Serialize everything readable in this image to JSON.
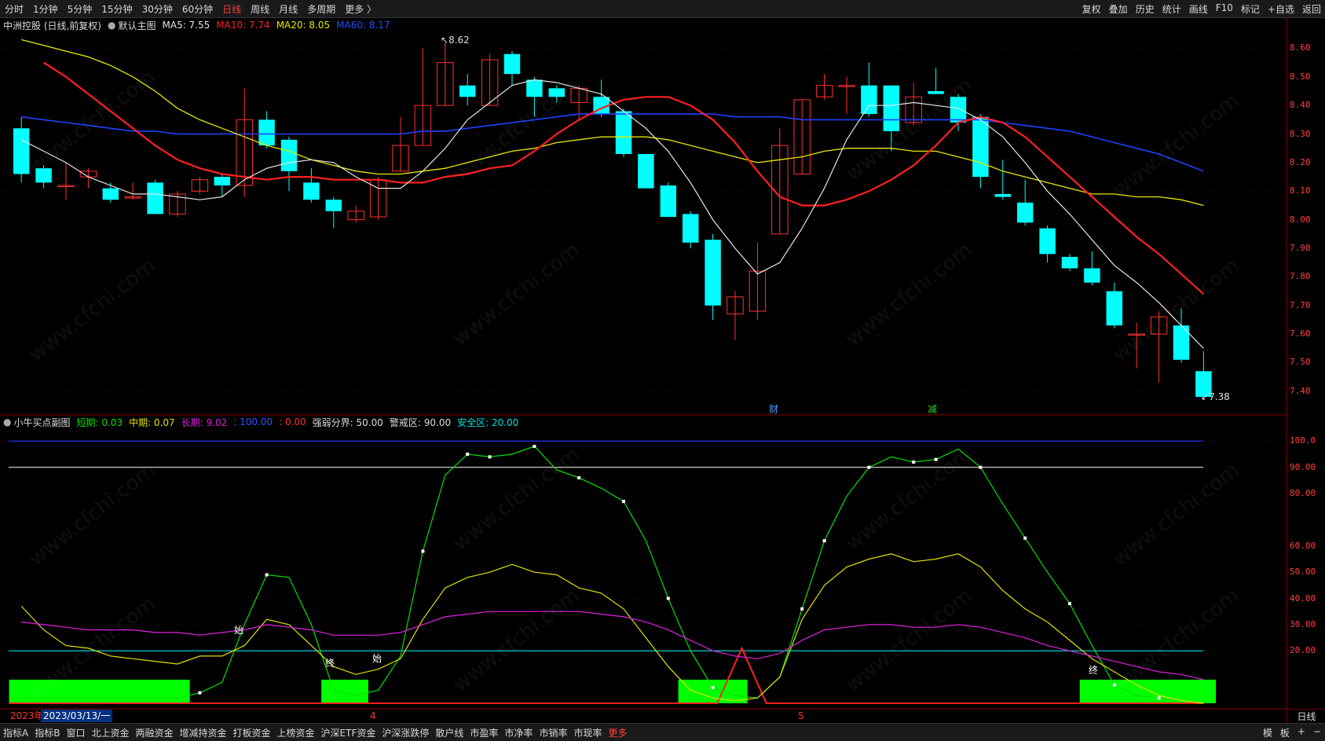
{
  "top_tabs": [
    {
      "label": "分时",
      "active": false
    },
    {
      "label": "1分钟",
      "active": false
    },
    {
      "label": "5分钟",
      "active": false
    },
    {
      "label": "15分钟",
      "active": false
    },
    {
      "label": "30分钟",
      "active": false
    },
    {
      "label": "60分钟",
      "active": false
    },
    {
      "label": "日线",
      "active": true
    },
    {
      "label": "周线",
      "active": false
    },
    {
      "label": "月线",
      "active": false
    },
    {
      "label": "多周期",
      "active": false
    },
    {
      "label": "更多 〉",
      "active": false
    }
  ],
  "right_tools": [
    "复权",
    "叠加",
    "历史",
    "统计",
    "画线",
    "F10",
    "标记",
    "+自选",
    "返回"
  ],
  "main_legend": {
    "title": "中洲控股 (日线,前复权)",
    "chart_name": "默认主图",
    "ma5": "MA5: 7.55",
    "ma10": "MA10: 7.74",
    "ma20": "MA20: 8.05",
    "ma60": "MA60: 8.17"
  },
  "sub_legend": {
    "title": "小牛买点副图",
    "short": "短期: 0.03",
    "mid": "中期: 0.07",
    "long": "长期: 9.02",
    "v100": ": 100.00",
    "v0": ": 0.00",
    "strong": "强弱分界: 50.00",
    "warn": "警戒区: 90.00",
    "safe": "安全区: 20.00"
  },
  "colors": {
    "up": "#ff3030",
    "down": "#00ffff",
    "ma5": "#e6e6e6",
    "ma10": "#ff2020",
    "ma20": "#e8e800",
    "ma60": "#2040ff",
    "short": "#00e000",
    "mid": "#e0e000",
    "long": "#e020e0"
  },
  "price_ticks": [
    "8.60",
    "8.50",
    "8.40",
    "8.30",
    "8.20",
    "8.10",
    "8.00",
    "7.90",
    "7.80",
    "7.70",
    "7.60",
    "7.50",
    "7.40"
  ],
  "sub_ticks": [
    "100.0",
    "90.00",
    "80.00",
    "60.00",
    "50.00",
    "40.00",
    "30.00",
    "20.00"
  ],
  "annotations": {
    "high": "8.62",
    "low": "7.38",
    "event1": "财",
    "event2": "减",
    "signal_start": "始",
    "signal_end": "终"
  },
  "axis": {
    "year": "2023年",
    "date": "2023/03/13/一",
    "month4": "4",
    "month5": "5",
    "period": "日线"
  },
  "bottom_tabs": [
    "指标A",
    "指标B",
    "窗口",
    "北上资金",
    "两融资金",
    "增减持资金",
    "打板资金",
    "上榜资金",
    "沪深ETF资金",
    "沪深涨跌停",
    "散户线",
    "市盈率",
    "市净率",
    "市销率",
    "市现率",
    "更多"
  ],
  "bottom_right": [
    "模",
    "板",
    "+",
    "−"
  ],
  "watermark": "www.cfchi.com",
  "chart_data": [
    {
      "type": "candlestick",
      "ylim": [
        7.35,
        8.67
      ],
      "candles": [
        [
          8.32,
          8.16,
          8.36,
          8.13
        ],
        [
          8.18,
          8.13,
          8.19,
          8.11
        ],
        [
          8.12,
          8.12,
          8.2,
          8.07
        ],
        [
          8.15,
          8.17,
          8.18,
          8.11
        ],
        [
          8.11,
          8.07,
          8.13,
          8.06
        ],
        [
          8.08,
          8.08,
          8.13,
          8.07
        ],
        [
          8.13,
          8.02,
          8.14,
          8.02
        ],
        [
          8.02,
          8.09,
          8.1,
          8.01
        ],
        [
          8.1,
          8.14,
          8.15,
          8.09
        ],
        [
          8.15,
          8.12,
          8.16,
          8.08
        ],
        [
          8.12,
          8.35,
          8.46,
          8.08
        ],
        [
          8.35,
          8.26,
          8.38,
          8.25
        ],
        [
          8.28,
          8.17,
          8.29,
          8.1
        ],
        [
          8.13,
          8.07,
          8.18,
          8.06
        ],
        [
          8.07,
          8.03,
          8.08,
          7.97
        ],
        [
          8.0,
          8.03,
          8.05,
          7.99
        ],
        [
          8.01,
          8.14,
          8.15,
          8.0
        ],
        [
          8.17,
          8.26,
          8.36,
          8.17
        ],
        [
          8.26,
          8.4,
          8.6,
          8.26
        ],
        [
          8.4,
          8.55,
          8.62,
          8.4
        ],
        [
          8.47,
          8.43,
          8.51,
          8.4
        ],
        [
          8.4,
          8.56,
          8.58,
          8.4
        ],
        [
          8.58,
          8.51,
          8.59,
          8.47
        ],
        [
          8.49,
          8.43,
          8.5,
          8.36
        ],
        [
          8.46,
          8.43,
          8.47,
          8.41
        ],
        [
          8.41,
          8.46,
          8.47,
          8.35
        ],
        [
          8.43,
          8.37,
          8.49,
          8.36
        ],
        [
          8.38,
          8.23,
          8.39,
          8.22
        ],
        [
          8.23,
          8.11,
          8.23,
          8.11
        ],
        [
          8.12,
          8.01,
          8.13,
          8.01
        ],
        [
          8.02,
          7.92,
          8.03,
          7.9
        ],
        [
          7.93,
          7.7,
          7.95,
          7.65
        ],
        [
          7.67,
          7.73,
          7.75,
          7.58
        ],
        [
          7.68,
          7.82,
          7.92,
          7.65
        ],
        [
          7.95,
          8.26,
          8.32,
          7.95
        ],
        [
          8.16,
          8.42,
          8.42,
          8.16
        ],
        [
          8.43,
          8.47,
          8.51,
          8.42
        ],
        [
          8.47,
          8.47,
          8.5,
          8.37
        ],
        [
          8.47,
          8.37,
          8.55,
          8.36
        ],
        [
          8.47,
          8.31,
          8.47,
          8.24
        ],
        [
          8.34,
          8.43,
          8.48,
          8.33
        ],
        [
          8.45,
          8.44,
          8.53,
          8.44
        ],
        [
          8.43,
          8.34,
          8.44,
          8.31
        ],
        [
          8.36,
          8.15,
          8.37,
          8.11
        ],
        [
          8.09,
          8.08,
          8.21,
          8.07
        ],
        [
          8.06,
          7.99,
          8.14,
          7.98
        ],
        [
          7.97,
          7.88,
          7.98,
          7.85
        ],
        [
          7.87,
          7.83,
          7.88,
          7.82
        ],
        [
          7.83,
          7.78,
          7.89,
          7.77
        ],
        [
          7.75,
          7.63,
          7.78,
          7.62
        ],
        [
          7.6,
          7.6,
          7.64,
          7.48
        ],
        [
          7.6,
          7.66,
          7.68,
          7.43
        ],
        [
          7.63,
          7.51,
          7.69,
          7.5
        ],
        [
          7.47,
          7.38,
          7.54,
          7.38
        ]
      ],
      "ma5": [
        8.28,
        8.24,
        8.2,
        8.15,
        8.12,
        8.09,
        8.09,
        8.08,
        8.07,
        8.08,
        8.14,
        8.18,
        8.2,
        8.21,
        8.2,
        8.15,
        8.11,
        8.11,
        8.17,
        8.25,
        8.35,
        8.41,
        8.47,
        8.49,
        8.48,
        8.46,
        8.44,
        8.38,
        8.32,
        8.24,
        8.13,
        8.0,
        7.9,
        7.81,
        7.85,
        7.97,
        8.11,
        8.28,
        8.4,
        8.4,
        8.41,
        8.4,
        8.39,
        8.35,
        8.29,
        8.2,
        8.1,
        8.02,
        7.93,
        7.84,
        7.78,
        7.71,
        7.63,
        7.55
      ],
      "ma10": [
        8.55,
        8.5,
        8.44,
        8.38,
        8.32,
        8.26,
        8.21,
        8.18,
        8.16,
        8.15,
        8.14,
        8.15,
        8.15,
        8.14,
        8.14,
        8.14,
        8.13,
        8.13,
        8.15,
        8.16,
        8.18,
        8.19,
        8.24,
        8.3,
        8.35,
        8.39,
        8.42,
        8.43,
        8.43,
        8.4,
        8.35,
        8.27,
        8.17,
        8.08,
        8.05,
        8.05,
        8.07,
        8.1,
        8.14,
        8.19,
        8.26,
        8.34,
        8.36,
        8.34,
        8.29,
        8.22,
        8.15,
        8.08,
        8.01,
        7.94,
        7.88,
        7.81,
        7.74
      ],
      "ma20": [
        8.63,
        8.61,
        8.59,
        8.57,
        8.54,
        8.5,
        8.45,
        8.39,
        8.35,
        8.32,
        8.29,
        8.26,
        8.24,
        8.21,
        8.19,
        8.17,
        8.16,
        8.16,
        8.17,
        8.18,
        8.2,
        8.22,
        8.24,
        8.25,
        8.27,
        8.28,
        8.29,
        8.29,
        8.29,
        8.28,
        8.26,
        8.24,
        8.22,
        8.2,
        8.21,
        8.22,
        8.24,
        8.25,
        8.25,
        8.25,
        8.24,
        8.24,
        8.22,
        8.2,
        8.17,
        8.15,
        8.13,
        8.11,
        8.09,
        8.09,
        8.08,
        8.08,
        8.07,
        8.05
      ],
      "ma60": [
        8.36,
        8.35,
        8.34,
        8.33,
        8.32,
        8.31,
        8.31,
        8.3,
        8.3,
        8.3,
        8.3,
        8.3,
        8.3,
        8.3,
        8.3,
        8.3,
        8.3,
        8.3,
        8.31,
        8.31,
        8.32,
        8.33,
        8.34,
        8.35,
        8.36,
        8.37,
        8.37,
        8.37,
        8.37,
        8.37,
        8.37,
        8.37,
        8.36,
        8.36,
        8.36,
        8.35,
        8.35,
        8.35,
        8.35,
        8.35,
        8.35,
        8.35,
        8.35,
        8.35,
        8.34,
        8.33,
        8.32,
        8.31,
        8.29,
        8.27,
        8.25,
        8.23,
        8.2,
        8.17
      ]
    },
    {
      "type": "line",
      "ylim": [
        0,
        104
      ],
      "series": [
        {
          "name": "短期",
          "values": [
            2,
            2,
            2,
            2,
            2,
            2,
            2,
            2,
            4,
            8,
            30,
            49,
            48,
            30,
            5,
            3,
            5,
            18,
            58,
            87,
            95,
            94,
            95,
            98,
            89,
            86,
            82,
            77,
            62,
            40,
            20,
            6,
            3,
            2,
            10,
            36,
            62,
            79,
            90,
            94,
            92,
            93,
            97,
            90,
            76,
            63,
            50,
            38,
            22,
            7,
            3,
            2,
            1,
            0
          ]
        },
        {
          "name": "中期",
          "values": [
            37,
            28,
            22,
            21,
            18,
            17,
            16,
            15,
            18,
            18,
            22,
            32,
            30,
            22,
            14,
            11,
            13,
            17,
            32,
            44,
            48,
            50,
            53,
            50,
            49,
            44,
            42,
            36,
            25,
            14,
            5,
            2,
            1,
            2,
            10,
            32,
            45,
            52,
            55,
            57,
            54,
            55,
            57,
            52,
            43,
            36,
            31,
            24,
            17,
            12,
            7,
            3,
            1,
            0
          ]
        },
        {
          "name": "长期",
          "values": [
            31,
            30,
            29,
            28,
            28,
            28,
            27,
            27,
            26,
            27,
            28,
            30,
            29,
            28,
            26,
            26,
            26,
            27,
            30,
            33,
            34,
            35,
            35,
            35,
            35,
            35,
            34,
            33,
            31,
            28,
            24,
            20,
            18,
            17,
            19,
            24,
            28,
            29,
            30,
            30,
            29,
            29,
            30,
            29,
            27,
            25,
            22,
            20,
            18,
            16,
            14,
            12,
            11,
            9
          ]
        }
      ],
      "reference_lines": [
        100,
        90,
        20,
        0
      ]
    }
  ]
}
